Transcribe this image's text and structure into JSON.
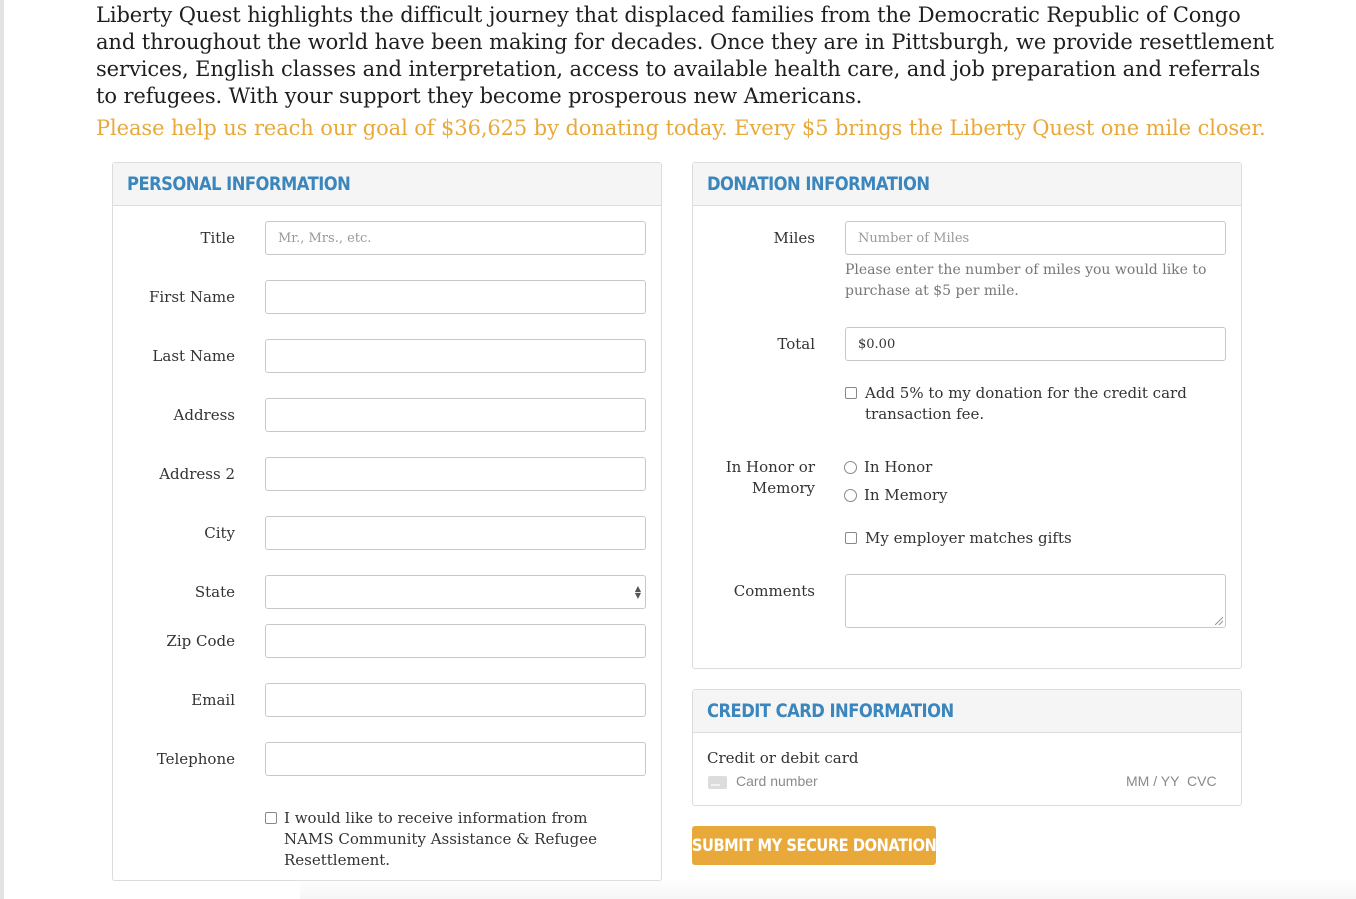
{
  "intro_text": "Liberty Quest highlights the difficult journey that displaced families from the Democratic Republic of Congo and throughout the world have been making for decades. Once they are in Pittsburgh, we provide resettlement services, English classes and interpretation, access to available health care, and job preparation and referrals to refugees. With your support they become prosperous new Americans.",
  "goal_text": "Please help us reach our goal of $36,625 by donating today. Every $5 brings the Liberty Quest one mile closer.",
  "personal": {
    "heading": "PERSONAL INFORMATION",
    "title_label": "Title",
    "title_placeholder": "Mr., Mrs., etc.",
    "first_name_label": "First Name",
    "last_name_label": "Last Name",
    "address_label": "Address",
    "address2_label": "Address 2",
    "city_label": "City",
    "state_label": "State",
    "state_value": "",
    "zip_label": "Zip Code",
    "email_label": "Email",
    "telephone_label": "Telephone",
    "optin_text": "I would like to receive information from NAMS Community Assistance & Refugee Resettlement.",
    "optin_checked": false
  },
  "donation": {
    "heading": "DONATION INFORMATION",
    "miles_label": "Miles",
    "miles_placeholder": "Number of Miles",
    "miles_help": "Please enter the number of miles you would like to purchase at $5 per mile.",
    "total_label": "Total",
    "total_value": "$0.00",
    "fee_text": "Add 5% to my donation for the credit card transaction fee.",
    "fee_checked": false,
    "honor_label": "In Honor or Memory",
    "honor_option": "In Honor",
    "memory_option": "In Memory",
    "employer_text": "My employer matches gifts",
    "employer_checked": false,
    "comments_label": "Comments"
  },
  "credit_card": {
    "heading": "CREDIT CARD INFORMATION",
    "card_label": "Credit or debit card",
    "card_number_placeholder": "Card number",
    "expiry_placeholder": "MM / YY",
    "cvc_placeholder": "CVC"
  },
  "submit_label": "SUBMIT MY SECURE DONATION",
  "colors": {
    "accent_blue": "#3a86bd",
    "accent_gold": "#e8a93a"
  }
}
